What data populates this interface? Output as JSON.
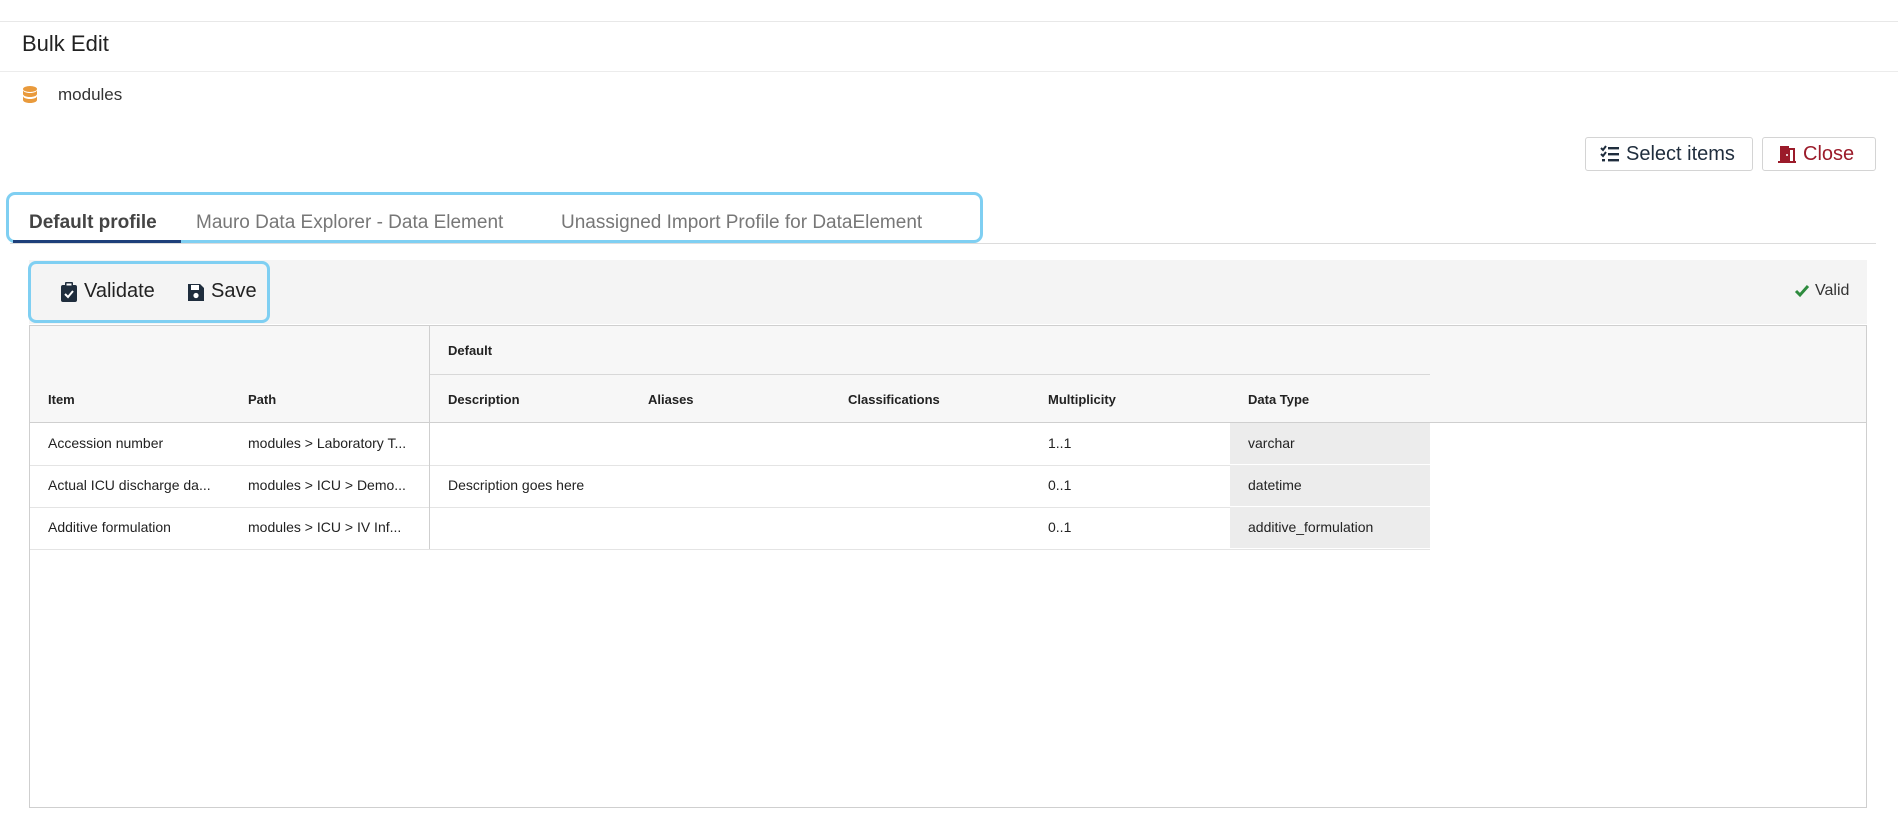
{
  "page": {
    "title": "Bulk Edit"
  },
  "breadcrumb": {
    "icon": "database-icon",
    "label": "modules"
  },
  "toolbar": {
    "select_items_label": "Select items",
    "close_label": "Close"
  },
  "tabs": [
    {
      "label": "Default profile",
      "active": true
    },
    {
      "label": "Mauro Data Explorer - Data Element",
      "active": false
    },
    {
      "label": "Unassigned Import Profile for DataElement",
      "active": false
    }
  ],
  "actions": {
    "validate_label": "Validate",
    "save_label": "Save",
    "status_label": "Valid"
  },
  "grid": {
    "group_header": "Default",
    "columns": [
      "Item",
      "Path",
      "Description",
      "Aliases",
      "Classifications",
      "Multiplicity",
      "Data Type"
    ],
    "rows": [
      [
        "Accession number",
        "modules > Laboratory T...",
        "",
        "",
        "",
        "1..1",
        "varchar"
      ],
      [
        "Actual ICU discharge da...",
        "modules > ICU > Demo...",
        "Description goes here",
        "",
        "",
        "0..1",
        "datetime"
      ],
      [
        "Additive formulation",
        "modules > ICU > IV Inf...",
        "",
        "",
        "",
        "0..1",
        "additive_formulation"
      ]
    ]
  },
  "colors": {
    "highlight_outline": "#7fcff2",
    "tab_active_underline": "#1d3f7a",
    "close_red": "#9b1b2a",
    "database_orange": "#e99a3c",
    "valid_green": "#2e8b3e"
  }
}
